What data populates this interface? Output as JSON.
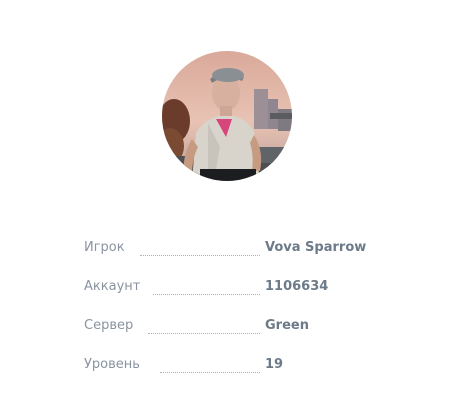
{
  "profile": {
    "avatar_icon": "player-avatar",
    "rows": [
      {
        "label": "Игрок",
        "value": "Vova Sparrow"
      },
      {
        "label": "Аккаунт",
        "value": "1106634"
      },
      {
        "label": "Сервер",
        "value": "Green"
      },
      {
        "label": "Уровень",
        "value": "19"
      }
    ]
  },
  "colors": {
    "label": "#8a94a0",
    "value": "#6c7a89",
    "dots": "#a9b1bb"
  }
}
